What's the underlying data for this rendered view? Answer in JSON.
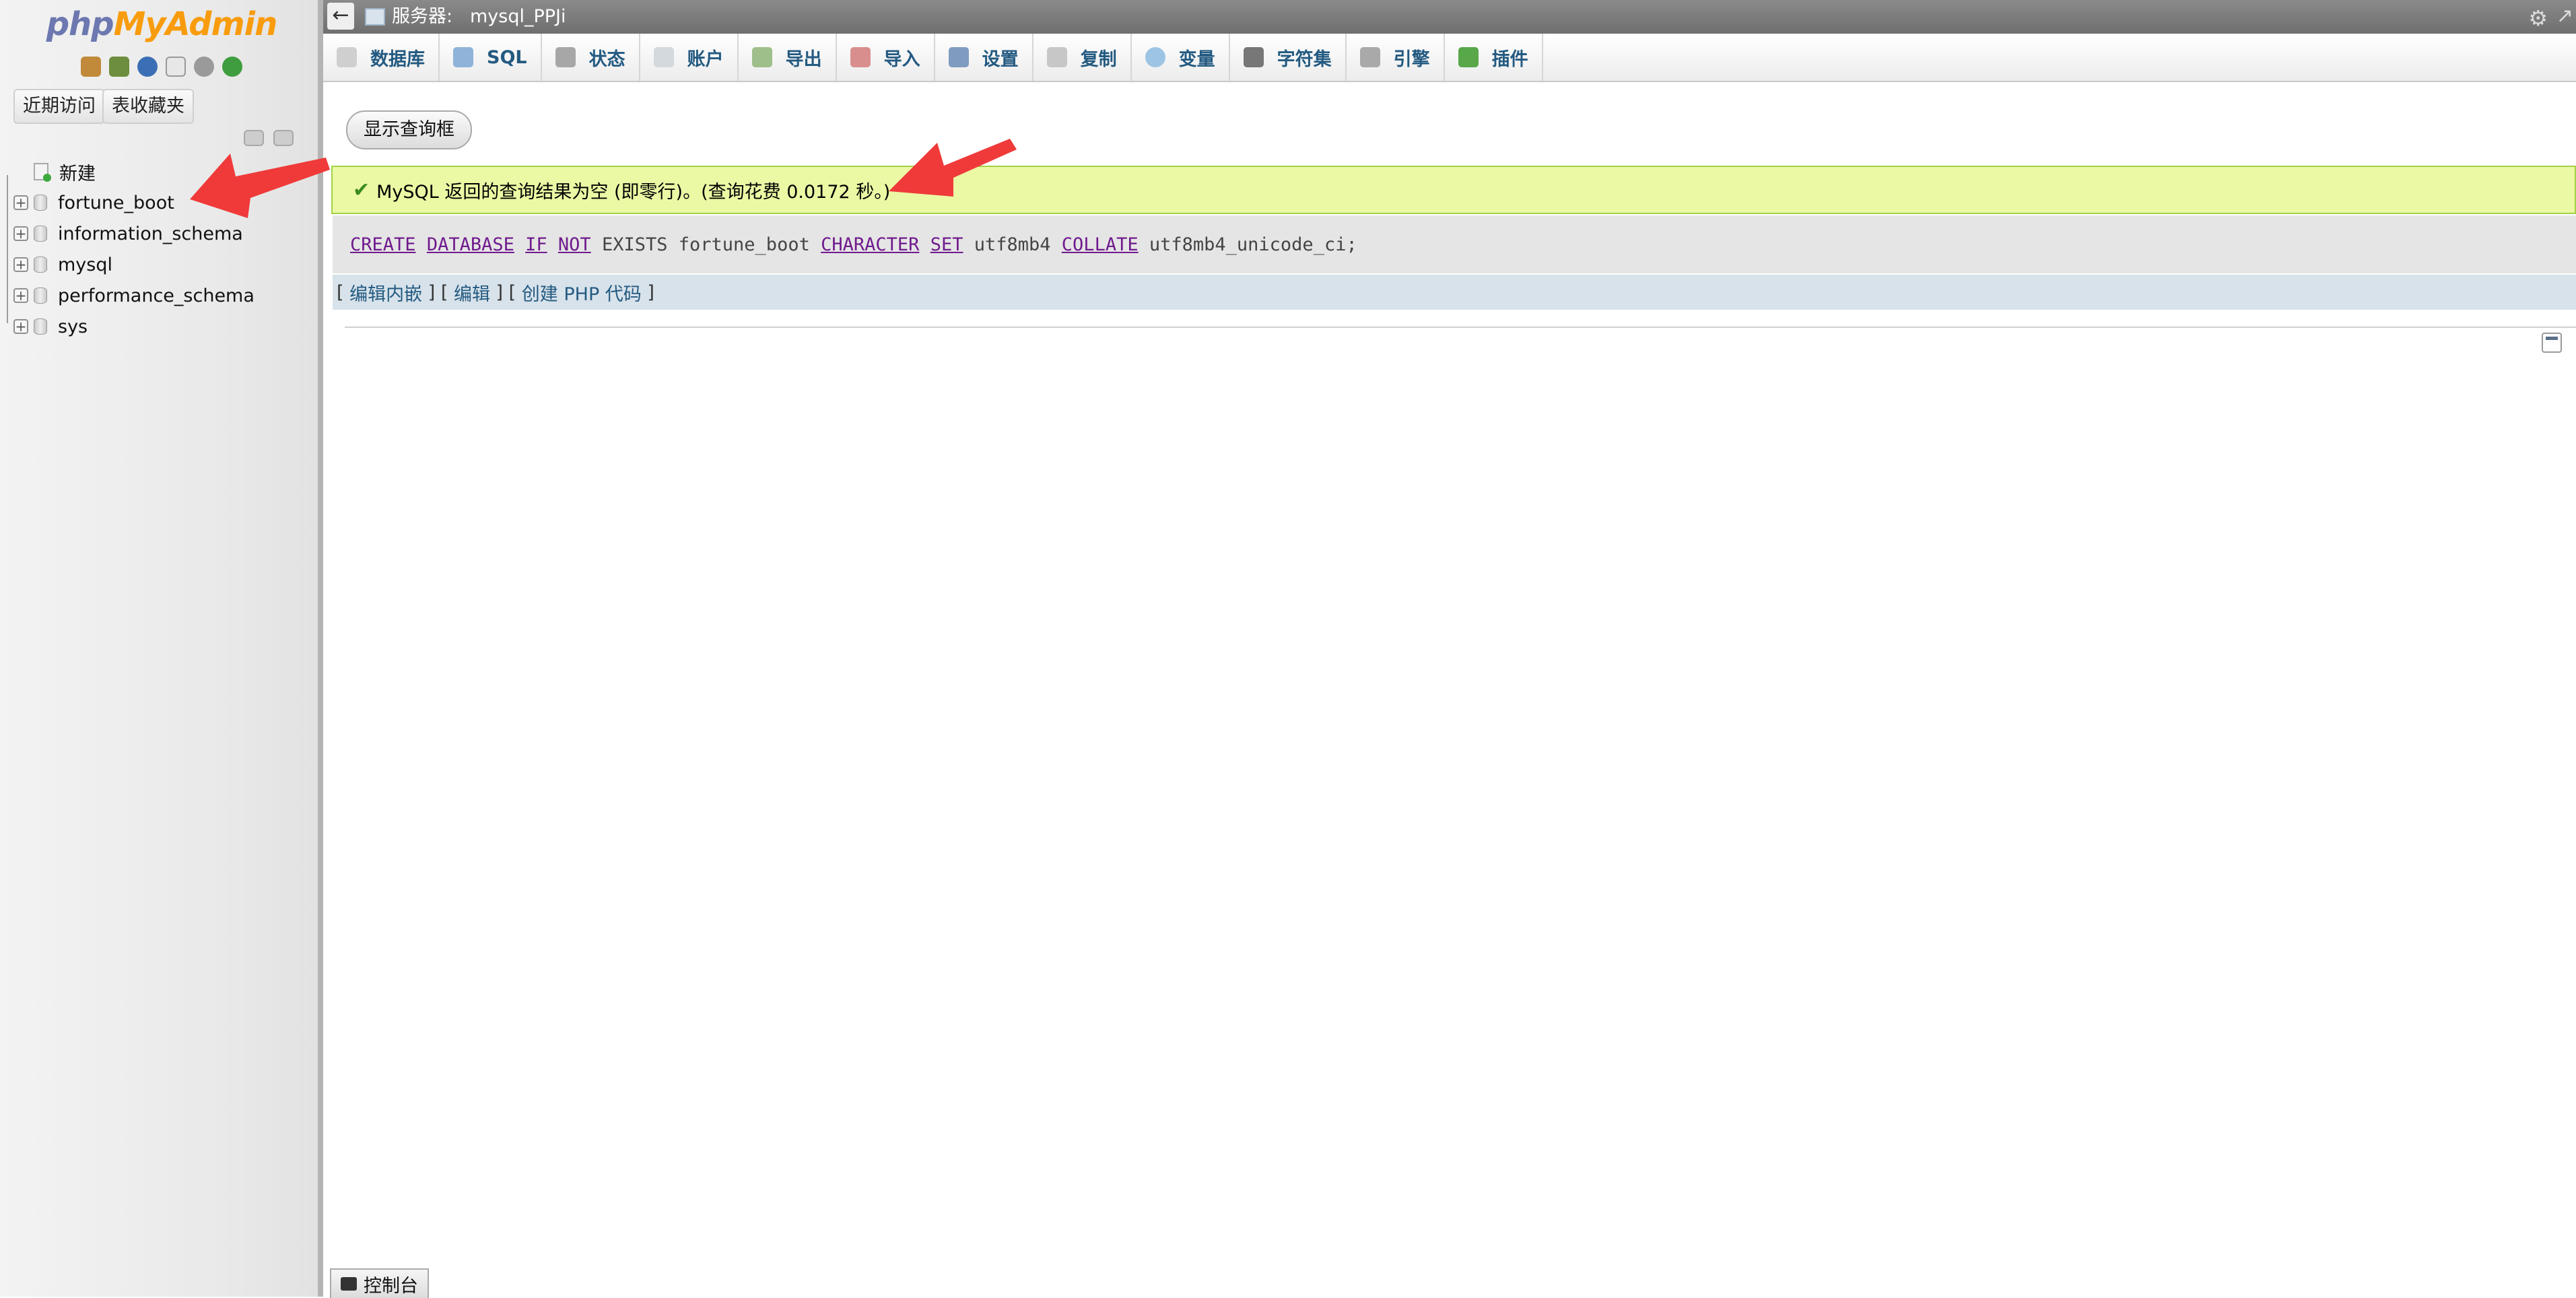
{
  "sidebar": {
    "logo": {
      "part1": "php",
      "part2": "MyAdmin"
    },
    "quick_icons": [
      "home-icon",
      "database-icon",
      "help-icon",
      "docs-icon",
      "settings-icon",
      "reload-icon"
    ],
    "buttons": {
      "recent": "近期访问",
      "favorites": "表收藏夹"
    },
    "tree": {
      "new": "新建",
      "databases": [
        "fortune_boot",
        "information_schema",
        "mysql",
        "performance_schema",
        "sys"
      ]
    }
  },
  "topbar": {
    "server_label": "服务器:",
    "server_name": "mysql_PPJi"
  },
  "tabs": [
    {
      "label": "数据库",
      "icon": "database-icon"
    },
    {
      "label": "SQL",
      "icon": "sql-icon"
    },
    {
      "label": "状态",
      "icon": "status-icon"
    },
    {
      "label": "账户",
      "icon": "accounts-icon"
    },
    {
      "label": "导出",
      "icon": "export-icon"
    },
    {
      "label": "导入",
      "icon": "import-icon"
    },
    {
      "label": "设置",
      "icon": "settings-icon"
    },
    {
      "label": "复制",
      "icon": "replication-icon"
    },
    {
      "label": "变量",
      "icon": "variables-icon"
    },
    {
      "label": "字符集",
      "icon": "charset-icon"
    },
    {
      "label": "引擎",
      "icon": "engine-icon"
    },
    {
      "label": "插件",
      "icon": "plugin-icon"
    }
  ],
  "main": {
    "show_query_button": "显示查询框",
    "success_message": "MySQL 返回的查询结果为空 (即零行)。(查询花费 0.0172 秒。)",
    "sql": {
      "kw_create": "CREATE",
      "kw_database": "DATABASE",
      "kw_if": "IF",
      "kw_not": "NOT",
      "kw_exists": "EXISTS",
      "db_name": "fortune_boot",
      "kw_character": "CHARACTER",
      "kw_set": "SET",
      "charset": "utf8mb4",
      "kw_collate": "COLLATE",
      "collation": "utf8mb4_unicode_ci;"
    },
    "links": {
      "edit_inline": "编辑内嵌",
      "edit": "编辑",
      "create_php": "创建 PHP 代码"
    }
  },
  "console": {
    "label": "控制台"
  },
  "colors": {
    "success_bg": "#ebf8a4",
    "link": "#235a81",
    "sql_keyword": "#701a8d",
    "annotation_arrow": "#f03a3a"
  }
}
